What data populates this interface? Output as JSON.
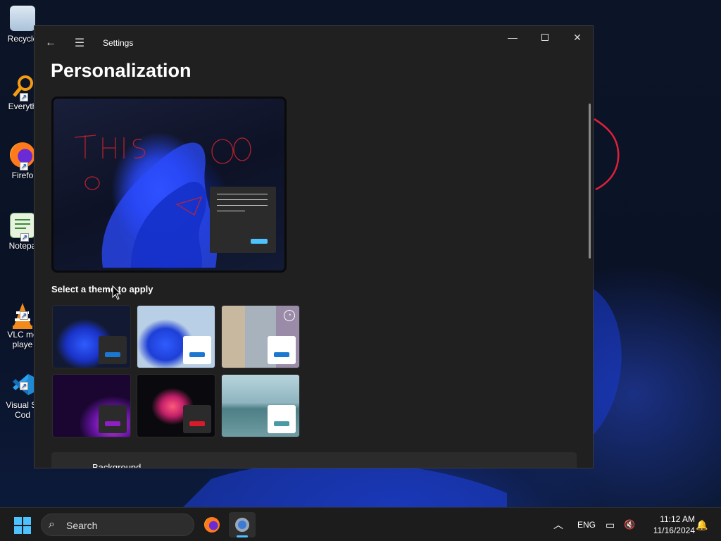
{
  "desktop": {
    "icons": [
      {
        "label": "Recycle",
        "icon": "recycle-bin-icon"
      },
      {
        "label": "Everyth",
        "icon": "everything-search-icon"
      },
      {
        "label": "Firefo",
        "icon": "firefox-icon"
      },
      {
        "label": "Notepa",
        "icon": "notepad-icon"
      },
      {
        "label": "VLC me\nplaye",
        "icon": "vlc-icon"
      },
      {
        "label": "Visual St\nCod",
        "icon": "vscode-icon"
      }
    ]
  },
  "window": {
    "title": "Settings",
    "back_icon": "back-arrow-icon",
    "menu_icon": "hamburger-menu-icon",
    "page_title": "Personalization",
    "theme_section_label": "Select a theme to apply",
    "themes": [
      {
        "name": "dark-bloom",
        "accent": "#1b78d0",
        "mini_bg": "#2b2b2b"
      },
      {
        "name": "light-bloom",
        "accent": "#1b78d0",
        "mini_bg": "#ffffff"
      },
      {
        "name": "glow",
        "accent": "#1b78d0",
        "mini_bg": "#ffffff"
      },
      {
        "name": "captured-motion",
        "accent": "#8d1fc4",
        "mini_bg": "#2b2b2b"
      },
      {
        "name": "flow",
        "accent": "#d81b2b",
        "mini_bg": "#2b2b2b"
      },
      {
        "name": "sunrise",
        "accent": "#4a9aa6",
        "mini_bg": "#ffffff"
      }
    ],
    "background_card_label": "Background"
  },
  "taskbar": {
    "search_placeholder": "Search",
    "language": "ENG",
    "time": "11:12 AM",
    "date": "11/16/2024",
    "accent": "#4cc2ff"
  }
}
